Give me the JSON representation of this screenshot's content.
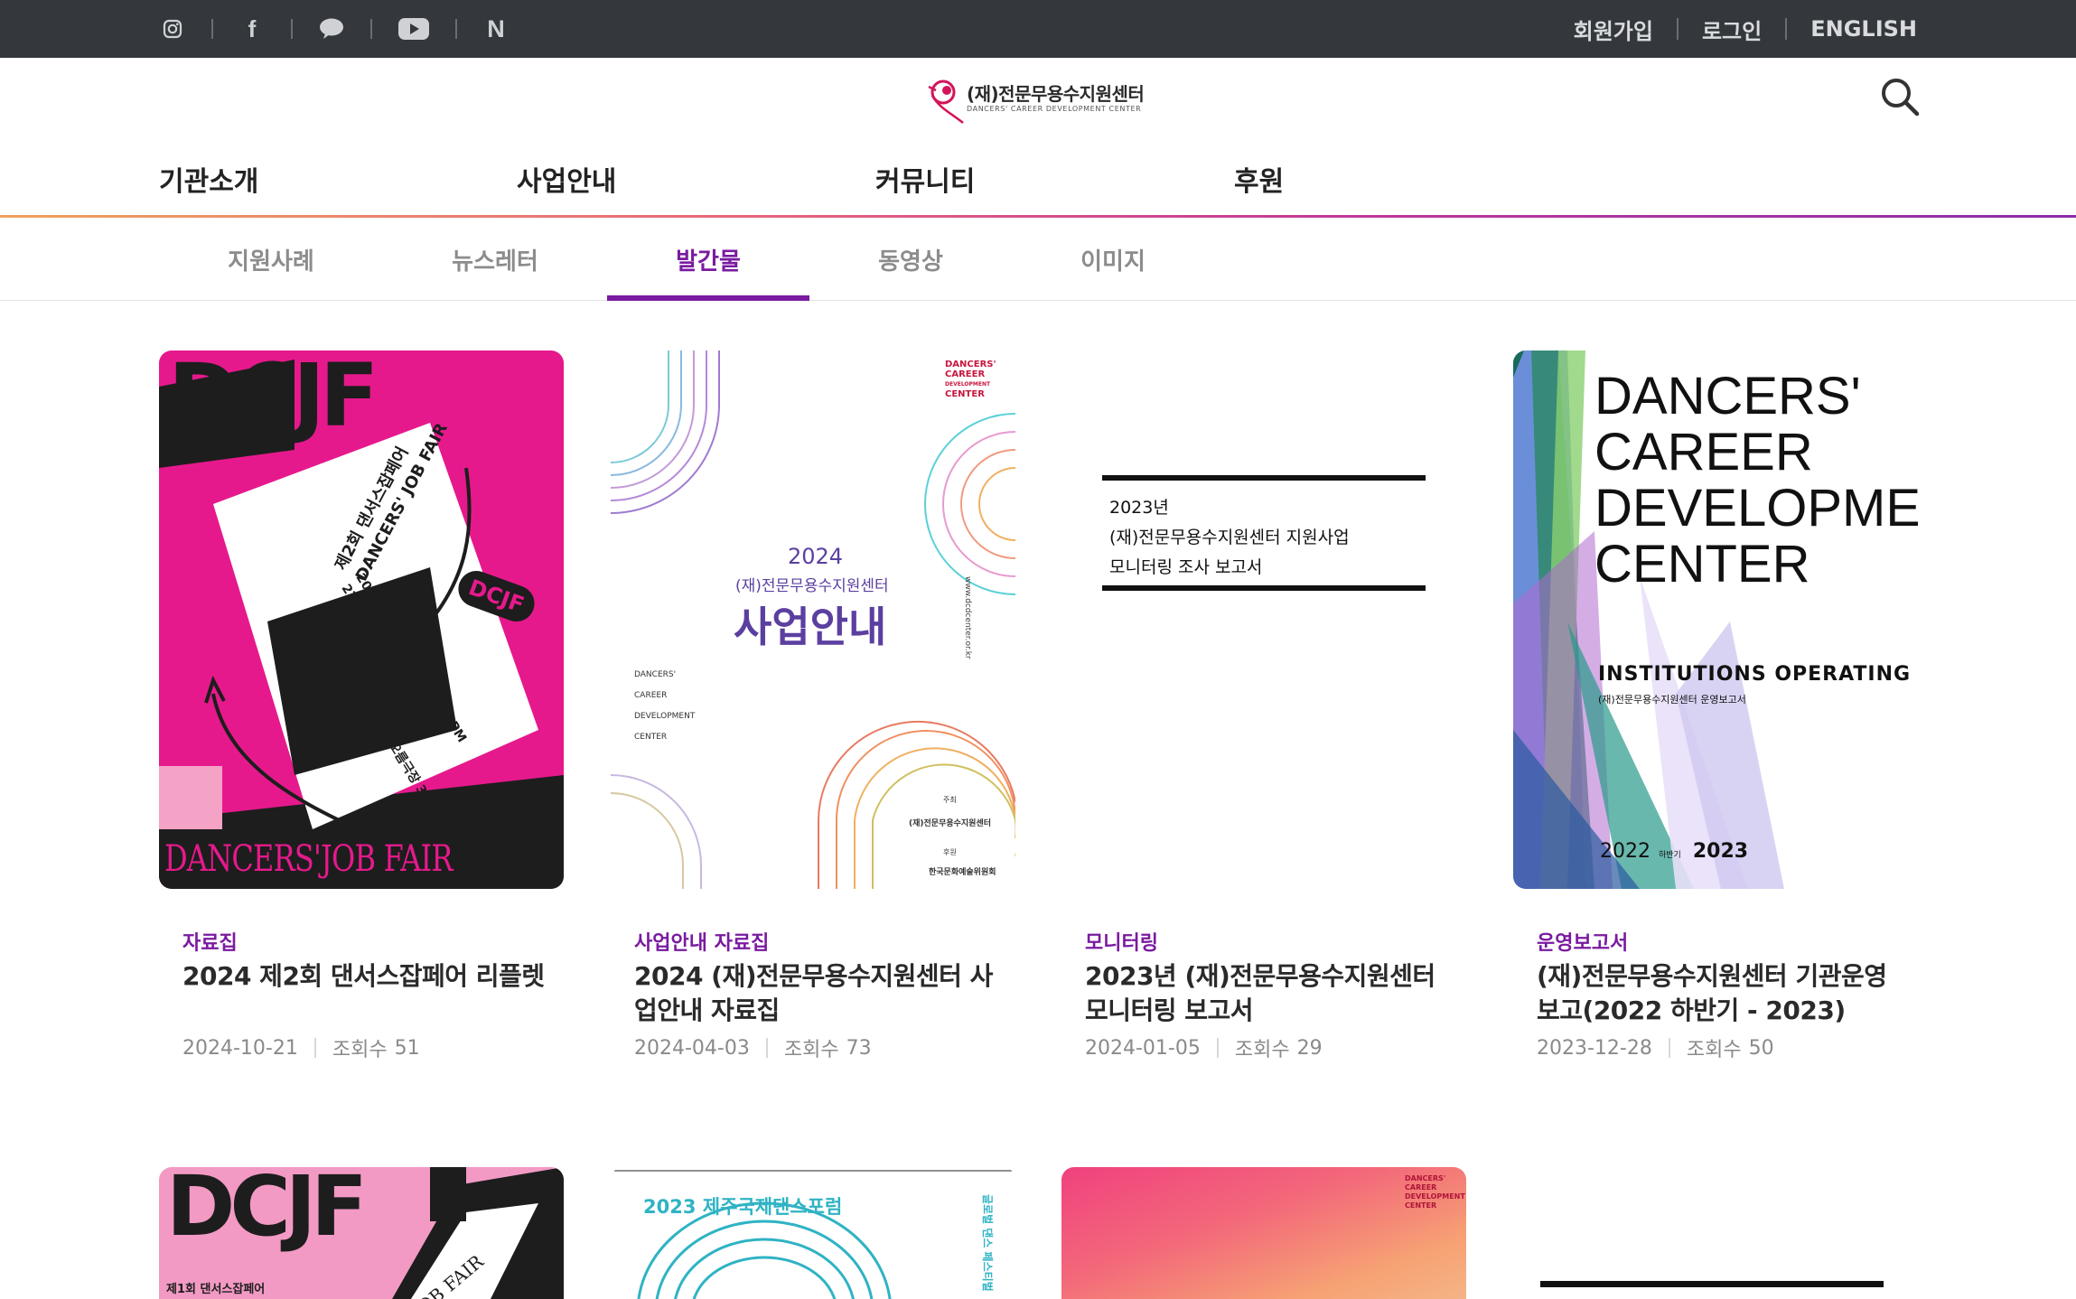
{
  "colors": {
    "topbar": "#34383d",
    "accent": "#7a1aa0",
    "card_category": "#7a1aa0"
  },
  "topbar": {
    "social": [
      {
        "name": "instagram-icon"
      },
      {
        "name": "facebook-icon",
        "glyph": "f"
      },
      {
        "name": "kakao-icon"
      },
      {
        "name": "youtube-icon"
      },
      {
        "name": "naver-icon",
        "glyph": "N"
      }
    ],
    "links": {
      "signup": "회원가입",
      "login": "로그인",
      "english": "ENGLISH"
    }
  },
  "logo": {
    "title": "(재)전문무용수지원센터",
    "subtitle": "DANCERS' CAREER DEVELOPMENT CENTER"
  },
  "gnb": [
    "기관소개",
    "사업안내",
    "커뮤니티",
    "후원"
  ],
  "subtabs": [
    {
      "label": "지원사례",
      "active": false
    },
    {
      "label": "뉴스레터",
      "active": false
    },
    {
      "label": "발간물",
      "active": true
    },
    {
      "label": "동영상",
      "active": false
    },
    {
      "label": "이미지",
      "active": false
    }
  ],
  "views_label": "조회수",
  "cards": [
    {
      "category": "자료집",
      "title": "2024 제2회 댄서스잡페어 리플렛",
      "date": "2024-10-21",
      "views": "51"
    },
    {
      "category": "사업안내 자료집",
      "title": "2024 (재)전문무용수지원센터 사업안내 자료집",
      "date": "2024-04-03",
      "views": "73"
    },
    {
      "category": "모니터링",
      "title": "2023년 (재)전문무용수지원센터 모니터링 보고서",
      "date": "2024-01-05",
      "views": "29"
    },
    {
      "category": "운영보고서",
      "title": "(재)전문무용수지원센터 기관운영보고(2022 하반기 - 2023)",
      "date": "2023-12-28",
      "views": "50"
    }
  ],
  "posters": {
    "p1": {
      "big": "DCJF",
      "line1": "제2회 댄서스잡페어",
      "line2": "DANCERS' JOB FAIR",
      "date1": "2024.9.26 (THU) 1PM - 7PM",
      "date2": "27 (FRI) 10AM - 7PM",
      "venue": "국립극장 해오름극장 3층 로비",
      "badge": "DCJF",
      "bottom": "DANCERS'JOB FAIR"
    },
    "p2": {
      "year": "2024",
      "org": "(재)전문무용수지원센터",
      "title": "사업안내",
      "side": [
        "DANCERS'",
        "CAREER",
        "DEVELOPMENT",
        "CENTER"
      ],
      "host_label": "주최",
      "host": "(재)전문무용수지원센터",
      "sponsor_label": "후원",
      "sponsor": "한국문화예술위원회",
      "url": "www.dcdcenter.or.kr"
    },
    "p3": {
      "line1": "2023년",
      "line2": "(재)전문무용수지원센터  지원사업",
      "line3": "모니터링  조사  보고서"
    },
    "p4": {
      "words": [
        "DANCERS'",
        "CAREER",
        "DEVELOPMENT",
        "CENTER"
      ],
      "subtitle": "INSTITUTIONS OPERATING REPORT",
      "sub_kr": "(재)전문무용수지원센터 운영보고서",
      "year_a": "2022",
      "year_half": "하반기",
      "year_b": "2023"
    },
    "p5": {
      "big": "DCJF",
      "kr": "제1회 댄서스잡페어",
      "slant": "JOB FAIR"
    },
    "p6": {
      "title": "2023 제주국제댄스포럼",
      "side": "글로벌 댄스 페스티벌"
    },
    "p7": {
      "logo": "DANCERS' CAREER DEVELOPMENT CENTER"
    }
  }
}
